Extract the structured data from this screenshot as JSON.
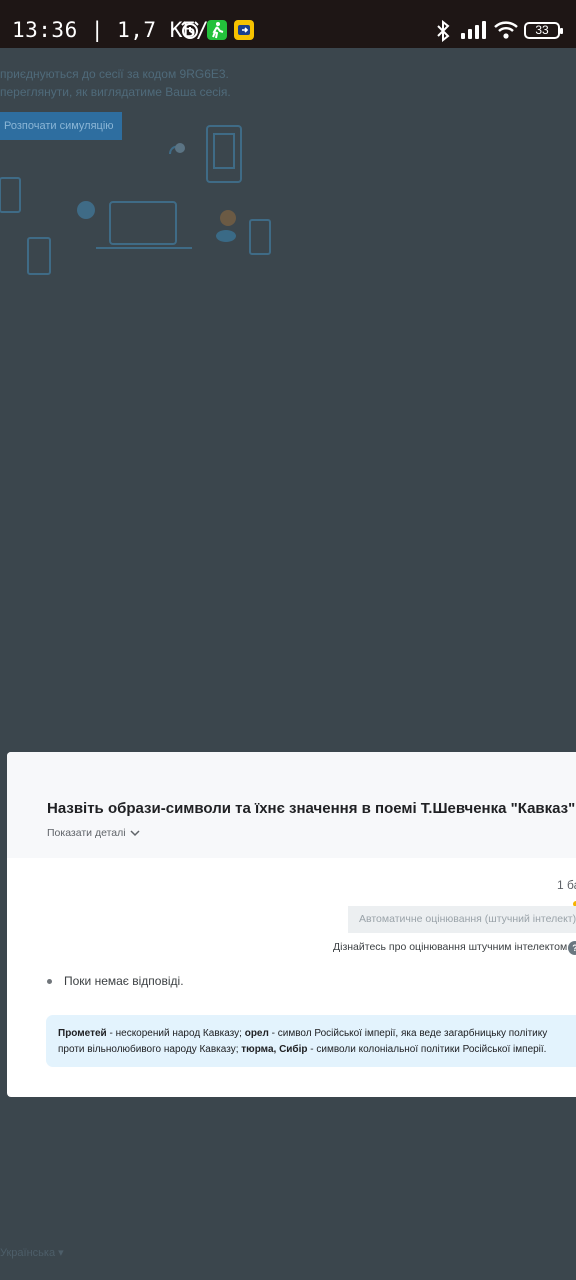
{
  "status_bar": {
    "time_speed": "13:36 | 1,7 КБ/с",
    "battery": "33",
    "icons": [
      "alarm-icon",
      "walk-icon",
      "navigation-icon",
      "bluetooth-icon",
      "signal-icon",
      "wifi-icon",
      "battery-icon"
    ]
  },
  "background": {
    "line1": "приєднуються до сесії за кодом 9RG6E3.",
    "line2": "переглянути, як виглядатиме Ваша сесія.",
    "button": "Розпочати симуляцію",
    "language": "Українська ▾"
  },
  "modal": {
    "question": "Назвіть образи-символи та їхнє значення в поемі Т.Шевченка \"Кавказ\".",
    "details_label": "Показати деталі",
    "score": "1 ба",
    "autograde_label": "Автоматичне оцінювання (штучний інтелект)",
    "learn_link": "Дізнайтесь про оцінювання штучним інтелектом",
    "help_label": "?",
    "no_answer": "Поки немає відповіді.",
    "answer": {
      "term1": "Прометей",
      "text1": " - нескорений народ Кавказу; ",
      "term2": "орел",
      "text2": " - символ Російської імперії, яка веде загарбницьку політику",
      "text3": "проти вільнолюбивого народу Кавказу; ",
      "term3": "тюрма, Сибір",
      "text4": " - символи колоніальної політики Російської імперії."
    }
  },
  "colors": {
    "overlay": "#3b464d",
    "status_bar": "#1e1615",
    "answer_bg": "#e3f3fd",
    "accent_yellow": "#f5b400"
  }
}
